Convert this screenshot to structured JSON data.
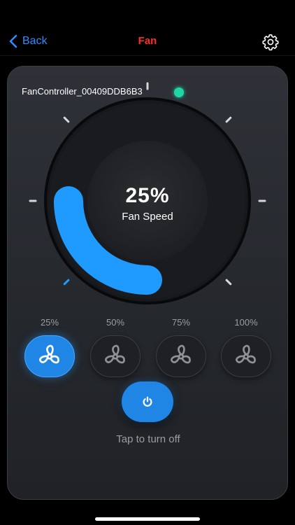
{
  "nav": {
    "back_label": "Back",
    "title": "Fan",
    "title_color": "#ff2d2d",
    "accent_color": "#2f8cff"
  },
  "device": {
    "name": "FanController_00409DDB6B3",
    "status": "online",
    "status_color": "#1ed6a6"
  },
  "dial": {
    "speed_text": "25%",
    "speed_fraction": 0.25,
    "label": "Fan Speed",
    "arc_color": "#1f9bff"
  },
  "presets": [
    {
      "label": "25%",
      "active": true,
      "icon": "fan-icon"
    },
    {
      "label": "50%",
      "active": false,
      "icon": "fan-icon"
    },
    {
      "label": "75%",
      "active": false,
      "icon": "fan-icon"
    },
    {
      "label": "100%",
      "active": false,
      "icon": "fan-icon"
    }
  ],
  "power": {
    "icon": "power-icon",
    "hint": "Tap to turn off"
  }
}
